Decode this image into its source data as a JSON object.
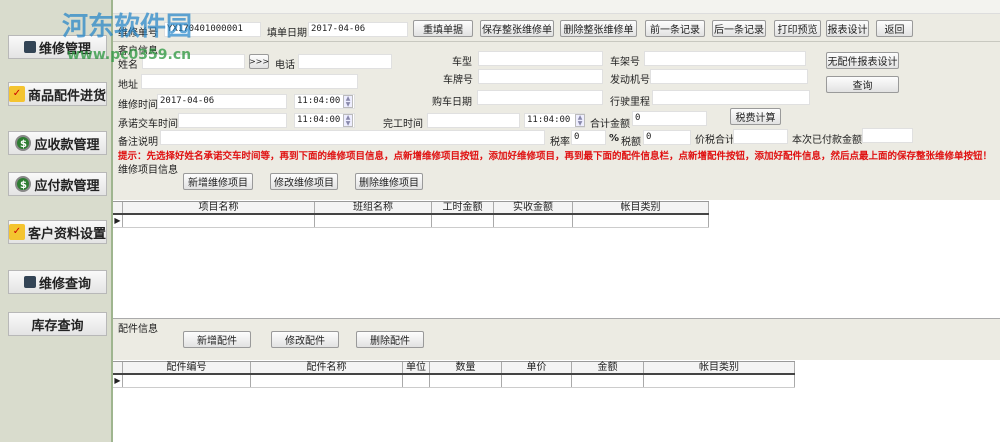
{
  "watermark": {
    "title": "河东软件园",
    "url": "www.pc0359.cn"
  },
  "sidebar": [
    {
      "label": "维修管理",
      "icon": "repair-icon"
    },
    {
      "label": "商品配件进货",
      "icon": "folder-check-icon"
    },
    {
      "label": "应收款管理",
      "icon": "money-bag-icon"
    },
    {
      "label": "应付款管理",
      "icon": "money-bag-icon"
    },
    {
      "label": "客户资料设置",
      "icon": "folder-check-icon"
    },
    {
      "label": "维修查询",
      "icon": "window-icon"
    },
    {
      "label": "库存查询",
      "icon": ""
    }
  ],
  "toolbar": {
    "order_no_label": "维修单号",
    "order_no": "YX170401000001",
    "fill_date_label": "填单日期",
    "fill_date": "2017-04-06",
    "buttons": [
      "重填单据",
      "保存整张维修单",
      "删除整张维修单",
      "前一条记录",
      "后一条记录",
      "打印预览",
      "报表设计",
      "返回"
    ]
  },
  "customer": {
    "section": "客户信息",
    "name_label": "姓名",
    "name": "",
    "lookup": ">>>",
    "phone_label": "电话",
    "address_label": "地址",
    "repair_time_label": "维修时间",
    "repair_date": "2017-04-06",
    "repair_time": "11:04:00",
    "promise_label": "承诺交车时间",
    "promise_time": "11:04:00",
    "complete_label": "完工时间",
    "complete_time": "11:04:00",
    "remark_label": "备注说明",
    "car_type_label": "车型",
    "plate_label": "车牌号",
    "buy_date_label": "购车日期",
    "frame_label": "车架号",
    "engine_label": "发动机号",
    "mileage_label": "行驶里程",
    "total_label": "合计金额",
    "total": "0",
    "tax_calc": "税费计算",
    "tax_rate_label": "税率",
    "tax_rate": "0",
    "percent": "%",
    "tax_label": "税额",
    "tax": "0",
    "price_tax_label": "价税合计",
    "paid_label": "本次已付款金额",
    "no_parts_report": "无配件报表设计",
    "query": "查询"
  },
  "hint": "提示：先选择好姓名承诺交车时间等，再到下面的维修项目信息，点新增维修项目按钮，添加好维修项目，再到最下面的配件信息栏，点新增配件按钮，添加好配件信息，然后点最上面的保存整张维修单按钮！",
  "items": {
    "section": "维修项目信息",
    "buttons": [
      "新增维修项目",
      "修改维修项目",
      "删除维修项目"
    ],
    "columns": [
      "项目名称",
      "班组名称",
      "工时金额",
      "实收金额",
      "帐目类别"
    ]
  },
  "parts": {
    "section": "配件信息",
    "buttons": [
      "新增配件",
      "修改配件",
      "删除配件"
    ],
    "columns": [
      "配件编号",
      "配件名称",
      "单位",
      "数量",
      "单价",
      "金额",
      "帐目类别"
    ]
  }
}
